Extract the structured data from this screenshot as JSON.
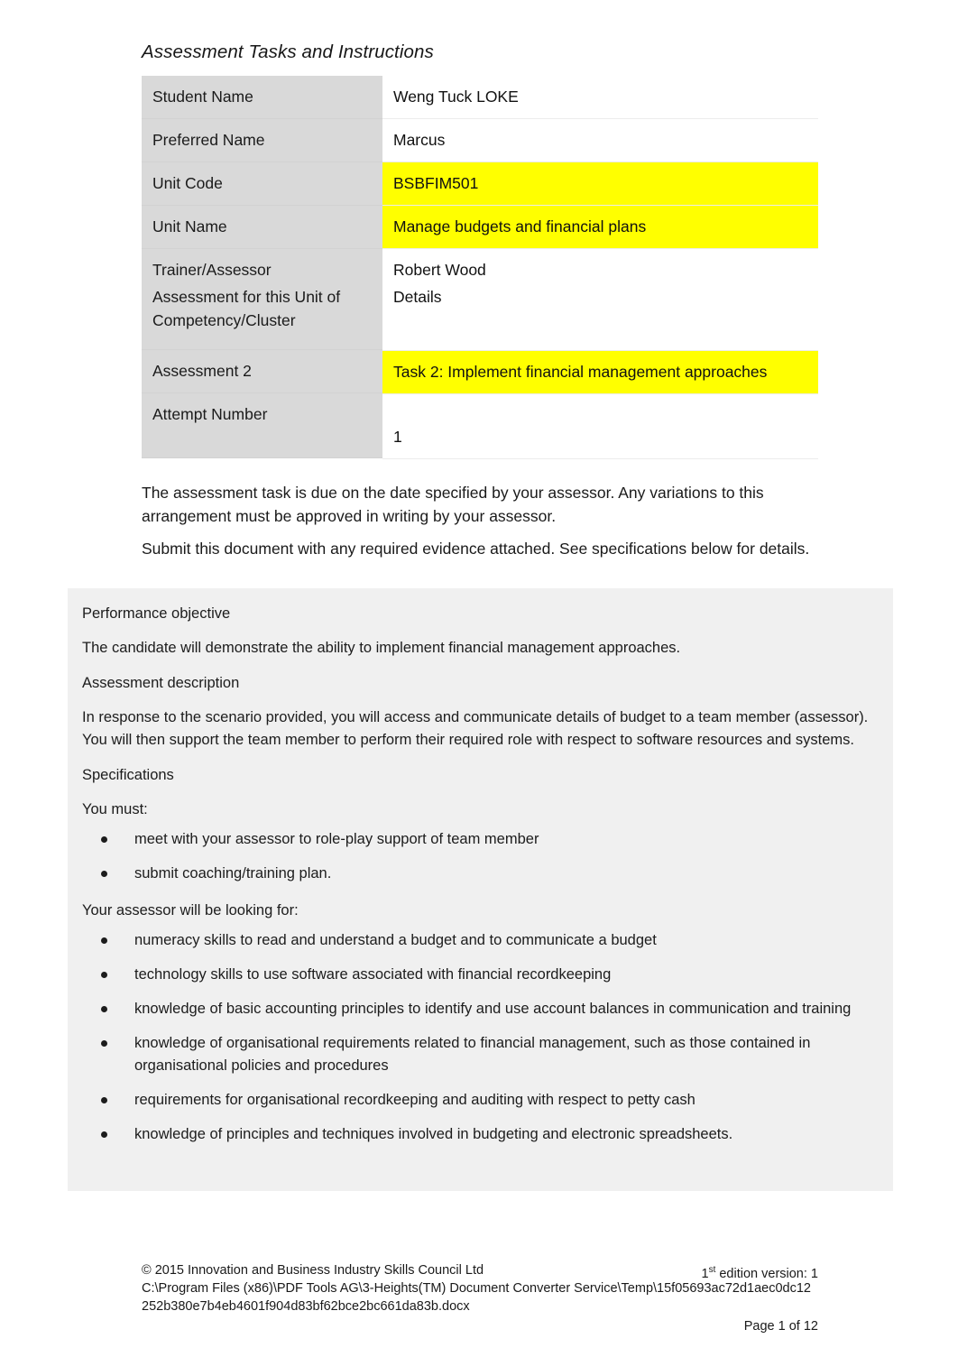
{
  "document": {
    "header_title": "Assessment Tasks and Instructions"
  },
  "student_table": {
    "rows": [
      {
        "label": "Student Name",
        "value": "Weng Tuck LOKE",
        "highlighted": false
      },
      {
        "label": "Preferred Name",
        "value": "Marcus",
        "highlighted": false
      },
      {
        "label": "Unit Code",
        "value": "BSBFIM501",
        "highlighted": true
      },
      {
        "label": "Unit Name",
        "value": "Manage budgets and financial plans",
        "highlighted": true
      },
      {
        "label": "Trainer/Assessor",
        "value": "Robert Wood",
        "highlighted": false
      }
    ]
  },
  "assessment_table": {
    "rows": [
      {
        "label": "Assessment for this Unit of Competency/Cluster",
        "value": "Details",
        "highlighted": false
      },
      {
        "label": "Assessment 2",
        "value": "Task 2: Implement financial management approaches",
        "highlighted": true
      },
      {
        "label": "Attempt Number",
        "value": "1",
        "highlighted": false
      }
    ]
  },
  "intro": {
    "paragraph_1": "The assessment task is due on the date specified by your assessor. Any variations to this arrangement must be approved in writing by your assessor.",
    "paragraph_2": "Submit this document with any required evidence attached. See specifications below for details."
  },
  "specifications_panel": {
    "performance_objective_heading": "Performance objective",
    "performance_objective_text": "The candidate will demonstrate the ability to implement financial management approaches.",
    "assessment_description_heading": "Assessment description",
    "assessment_description_text": "In response to the scenario provided, you will access and communicate details of budget to a team member (assessor). You will then support the team member to perform their required role with respect to software resources and systems.",
    "specifications_heading": "Specifications",
    "you_must_heading": "You must:",
    "you_must_items": [
      "meet with your assessor to role-play support of team member",
      "submit coaching/training plan."
    ],
    "assessor_heading": "Your assessor will be looking for:",
    "assessor_items": [
      "numeracy skills to read and understand a budget and to communicate a budget",
      "technology skills to use software associated with financial recordkeeping",
      "knowledge of basic accounting principles to identify and use account balances in communication and training",
      "knowledge of organisational requirements related to financial management, such as those contained in organisational policies and procedures",
      "requirements for organisational recordkeeping and auditing with respect to petty cash",
      "knowledge of principles and techniques involved in budgeting and electronic spreadsheets."
    ]
  },
  "footer": {
    "copyright": "© 2015 Innovation and Business Industry Skills Council Ltd",
    "edition_prefix": "1",
    "edition_superscript": "st",
    "edition_suffix": " edition version: 1",
    "file_path": "C:\\Program Files (x86)\\PDF Tools AG\\3-Heights(TM) Document Converter Service\\Temp\\15f05693ac72d1aec0dc12252b380e7b4eb4601f904d83bf62bce2bc661da83b.docx",
    "page_number": "Page 1 of 12"
  },
  "colors": {
    "highlight": "#ffff00",
    "label_cell": "#d9d9d9",
    "panel_background": "#f0f0f0",
    "page_background": "#ffffff"
  }
}
